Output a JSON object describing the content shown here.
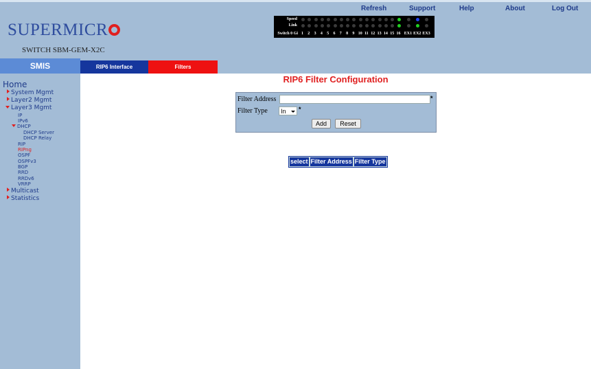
{
  "header": {
    "logo_text": "SUPERMICR",
    "switch_name": "SWITCH SBM-GEM-X2C",
    "links": [
      "Refresh",
      "Support",
      "Help",
      "About",
      "Log Out"
    ]
  },
  "ports": {
    "row_labels": [
      "Speed",
      "Link",
      "Switch 0 Gi"
    ],
    "numbers": [
      "1",
      "2",
      "3",
      "4",
      "5",
      "6",
      "7",
      "8",
      "9",
      "10",
      "11",
      "12",
      "13",
      "14",
      "15",
      "16",
      "EX1",
      "EX2",
      "EX3"
    ],
    "speed_led_colors": [
      "off",
      "off",
      "off",
      "off",
      "off",
      "off",
      "off",
      "off",
      "off",
      "off",
      "off",
      "off",
      "off",
      "off",
      "off",
      "green",
      "off",
      "blue",
      "off"
    ],
    "link_led_colors": [
      "off",
      "off",
      "off",
      "off",
      "off",
      "off",
      "off",
      "off",
      "off",
      "off",
      "off",
      "off",
      "off",
      "off",
      "off",
      "green",
      "off",
      "green",
      "off"
    ]
  },
  "nav": {
    "smis_label": "SMIS",
    "tabs": [
      {
        "label": "RIP6 Interface",
        "active": false
      },
      {
        "label": "Filters",
        "active": true
      }
    ]
  },
  "sidebar": {
    "home": "Home",
    "items": [
      {
        "label": "System Mgmt",
        "expander": "right"
      },
      {
        "label": "Layer2 Mgmt",
        "expander": "right"
      },
      {
        "label": "Layer3 Mgmt",
        "expander": "down"
      },
      {
        "label": "IP"
      },
      {
        "label": "IPv6"
      },
      {
        "label": "DHCP",
        "expander": "down"
      },
      {
        "label": "DHCP Server"
      },
      {
        "label": "DHCP Relay"
      },
      {
        "label": "RIP"
      },
      {
        "label": "RIPng",
        "selected": true
      },
      {
        "label": "OSPF"
      },
      {
        "label": "OSPFv3"
      },
      {
        "label": "BGP"
      },
      {
        "label": "RRD"
      },
      {
        "label": "RRDv6"
      },
      {
        "label": "VRRP"
      },
      {
        "label": "Multicast",
        "expander": "right"
      },
      {
        "label": "Statistics",
        "expander": "right"
      }
    ]
  },
  "main": {
    "title": "RIP6 Filter Configuration",
    "form": {
      "address_label": "Filter Address",
      "address_value": "",
      "type_label": "Filter Type",
      "type_value": "In",
      "required_mark": "*",
      "add_button": "Add",
      "reset_button": "Reset"
    },
    "table": {
      "headers": [
        "select",
        "Filter Address",
        "Filter Type"
      ]
    }
  },
  "colors": {
    "header_bg": "#a3bcd6",
    "tab_active": "#ee1111",
    "tab_inactive": "#15369d",
    "title_red": "#e02020",
    "link_blue": "#1f3b8a"
  }
}
